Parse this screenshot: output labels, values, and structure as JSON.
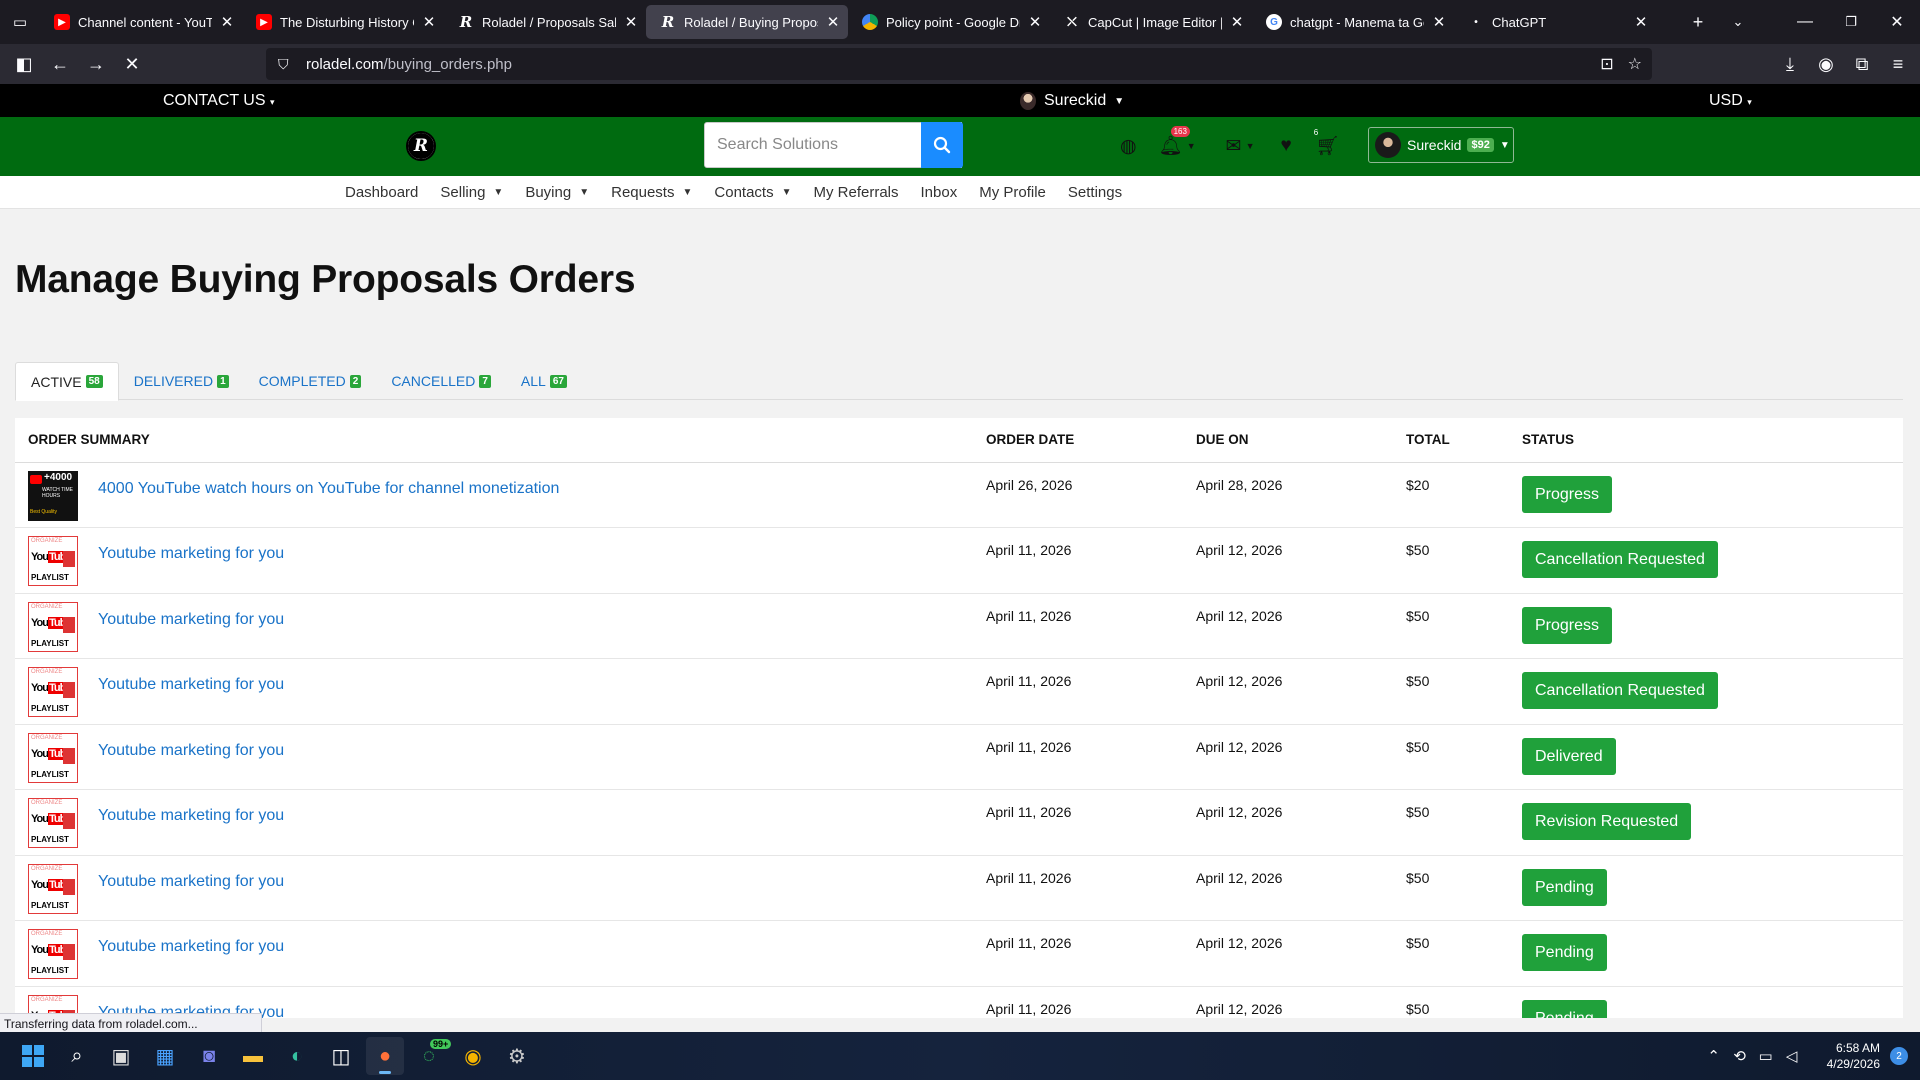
{
  "browser": {
    "tabs": [
      {
        "title": "Channel content - YouTube",
        "favicon": "youtube-icon",
        "active": false
      },
      {
        "title": "The Disturbing History Of M",
        "favicon": "youtube-icon",
        "active": false
      },
      {
        "title": "Roladel / Proposals Sales O",
        "favicon": "roladel-icon",
        "active": false
      },
      {
        "title": "Roladel / Buying Proposals",
        "favicon": "roladel-icon",
        "active": true
      },
      {
        "title": "Policy point - Google Drive",
        "favicon": "google-drive-icon",
        "active": false
      },
      {
        "title": "CapCut | Image Editor | All-",
        "favicon": "capcut-icon",
        "active": false
      },
      {
        "title": "chatgpt - Manema ta Goog",
        "favicon": "google-icon",
        "active": false
      },
      {
        "title": "ChatGPT",
        "favicon": "chatgpt-icon",
        "active": false
      }
    ],
    "url_domain": "roladel.com",
    "url_path": "/buying_orders.php",
    "status_text": "Transferring data from roladel.com..."
  },
  "site_top": {
    "contact": "CONTACT US",
    "username": "Sureckid",
    "currency": "USD"
  },
  "header": {
    "logo_letter": "R",
    "search_placeholder": "Search Solutions",
    "notifications_count": "163",
    "cart_count": "6",
    "user_name": "Sureckid",
    "balance": "$92"
  },
  "submenu": [
    {
      "label": "Dashboard",
      "dropdown": false
    },
    {
      "label": "Selling",
      "dropdown": true
    },
    {
      "label": "Buying",
      "dropdown": true
    },
    {
      "label": "Requests",
      "dropdown": true
    },
    {
      "label": "Contacts",
      "dropdown": true
    },
    {
      "label": "My Referrals",
      "dropdown": false
    },
    {
      "label": "Inbox",
      "dropdown": false
    },
    {
      "label": "My Profile",
      "dropdown": false
    },
    {
      "label": "Settings",
      "dropdown": false
    }
  ],
  "page_title": "Manage Buying Proposals Orders",
  "order_tabs": [
    {
      "label": "ACTIVE",
      "count": "58",
      "active": true
    },
    {
      "label": "DELIVERED",
      "count": "1",
      "active": false
    },
    {
      "label": "COMPLETED",
      "count": "2",
      "active": false
    },
    {
      "label": "CANCELLED",
      "count": "7",
      "active": false
    },
    {
      "label": "ALL",
      "count": "67",
      "active": false
    }
  ],
  "table": {
    "headers": [
      "ORDER SUMMARY",
      "ORDER DATE",
      "DUE ON",
      "TOTAL",
      "STATUS"
    ],
    "rows": [
      {
        "title": "4000 YouTube watch hours on YouTube for channel monetization",
        "thumb": "yt4000",
        "order_date": "April 26, 2026",
        "due_on": "April 28, 2026",
        "total": "$20",
        "status": "Progress"
      },
      {
        "title": "Youtube marketing for you",
        "thumb": "organize",
        "order_date": "April 11, 2026",
        "due_on": "April 12, 2026",
        "total": "$50",
        "status": "Cancellation Requested"
      },
      {
        "title": "Youtube marketing for you",
        "thumb": "organize",
        "order_date": "April 11, 2026",
        "due_on": "April 12, 2026",
        "total": "$50",
        "status": "Progress"
      },
      {
        "title": "Youtube marketing for you",
        "thumb": "organize",
        "order_date": "April 11, 2026",
        "due_on": "April 12, 2026",
        "total": "$50",
        "status": "Cancellation Requested"
      },
      {
        "title": "Youtube marketing for you",
        "thumb": "organize",
        "order_date": "April 11, 2026",
        "due_on": "April 12, 2026",
        "total": "$50",
        "status": "Delivered"
      },
      {
        "title": "Youtube marketing for you",
        "thumb": "organize",
        "order_date": "April 11, 2026",
        "due_on": "April 12, 2026",
        "total": "$50",
        "status": "Revision Requested"
      },
      {
        "title": "Youtube marketing for you",
        "thumb": "organize",
        "order_date": "April 11, 2026",
        "due_on": "April 12, 2026",
        "total": "$50",
        "status": "Pending"
      },
      {
        "title": "Youtube marketing for you",
        "thumb": "organize",
        "order_date": "April 11, 2026",
        "due_on": "April 12, 2026",
        "total": "$50",
        "status": "Pending"
      },
      {
        "title": "Youtube marketing for you",
        "thumb": "organize",
        "order_date": "April 11, 2026",
        "due_on": "April 12, 2026",
        "total": "$50",
        "status": "Pending"
      }
    ]
  },
  "thumb_text": {
    "yt4000_big": "+4000",
    "yt4000_small": "WATCH TIME HOURS",
    "yt4000_quality": "Best Quality",
    "org_top": "ORGANIZE",
    "org_you": "You",
    "org_tube": "Tube",
    "org_bottom": "PLAYLIST"
  },
  "taskbar": {
    "whatsapp_badge": "99+",
    "time": "6:58 AM",
    "date": "4/29/2026",
    "notification_count": "2"
  },
  "colors": {
    "header_green": "#006b10",
    "status_green": "#20a13b",
    "link_blue": "#1a73c8",
    "search_blue": "#1a8cff"
  }
}
